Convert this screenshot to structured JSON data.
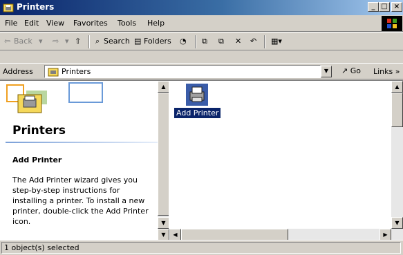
{
  "window": {
    "title": "Printers"
  },
  "menu": {
    "items": [
      "File",
      "Edit",
      "View",
      "Favorites",
      "Tools",
      "Help"
    ]
  },
  "toolbar": {
    "back_label": "Back",
    "search_label": "Search",
    "folders_label": "Folders"
  },
  "address": {
    "label": "Address",
    "value": "Printers",
    "go_label": "Go",
    "links_label": "Links"
  },
  "left_pane": {
    "title": "Printers",
    "subtitle": "Add Printer",
    "description": "The Add Printer wizard gives you step-by-step instructions for installing a printer. To install a new printer, double-click the Add Printer icon."
  },
  "items": [
    {
      "label": "Add Printer",
      "selected": true
    }
  ],
  "status": {
    "text": "1 object(s) selected"
  },
  "colors": {
    "title_bar": "#0a246a",
    "selection": "#0a246a",
    "chrome": "#d4d0c8"
  },
  "icons": [
    "printer-folder-icon",
    "windows-flag-icon",
    "back-arrow-icon",
    "forward-arrow-icon",
    "up-folder-icon",
    "search-icon",
    "folders-icon",
    "history-icon",
    "move-to-icon",
    "copy-to-icon",
    "delete-icon",
    "undo-icon",
    "views-icon",
    "go-arrow-icon",
    "add-printer-icon"
  ]
}
